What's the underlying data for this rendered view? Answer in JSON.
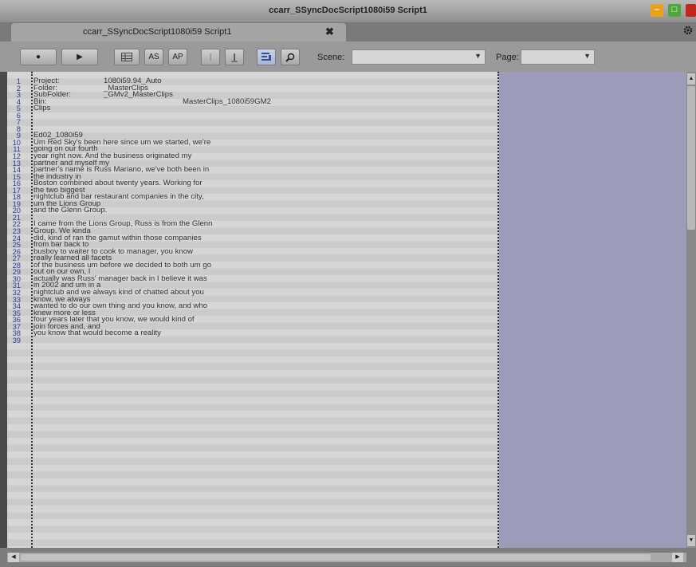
{
  "window": {
    "title": "ccarr_SSyncDocScript1080i59 Script1",
    "minimize_glyph": "–",
    "maximize_glyph": "□"
  },
  "tab": {
    "label": "ccarr_SSyncDocScript1080i59 Script1",
    "close_glyph": "✖"
  },
  "toolbar": {
    "record_glyph": "●",
    "play_glyph": "▶",
    "as_label": "AS",
    "ap_label": "AP",
    "scene_label": "Scene:",
    "scene_value": "",
    "page_label": "Page:",
    "page_value": ""
  },
  "icons": {
    "record": "record-icon",
    "play": "play-icon",
    "grid": "grid-icon",
    "text-cursor": "text-cursor-icon",
    "text-cursor-add": "text-cursor-add-icon",
    "script-lines": "script-lines-icon",
    "find": "find-icon",
    "settings": "gear-icon"
  },
  "colors": {
    "line_number": "#2d3b92",
    "page_background": "#d6d6d6",
    "margin_background": "#9c9cba"
  },
  "script": {
    "lines": [
      {
        "n": "1",
        "t": "Project:",
        "t2": "1080i59.94_Auto"
      },
      {
        "n": "2",
        "t": "Folder:",
        "t2": "_MasterClips"
      },
      {
        "n": "3",
        "t": "SubFolder:",
        "t2": "_GMv2_MasterClips"
      },
      {
        "n": "4",
        "t": "Bin:",
        "t3": "MasterClips_1080i59GM2"
      },
      {
        "n": "5",
        "t": "Clips"
      },
      {
        "n": "6",
        "t": ""
      },
      {
        "n": "7",
        "t": ""
      },
      {
        "n": "8",
        "t": ""
      },
      {
        "n": "9",
        "t": "Ed02_1080i59"
      },
      {
        "n": "10",
        "t": "Um Red Sky's been here since um we started, we're"
      },
      {
        "n": "11",
        "t": "going on our fourth"
      },
      {
        "n": "12",
        "t": "year right now.  And  the business originated my"
      },
      {
        "n": "13",
        "t": "partner and myself my"
      },
      {
        "n": "14",
        "t": "partner's name is Russ Mariano, we've both been in"
      },
      {
        "n": "15",
        "t": "the industry in"
      },
      {
        "n": "16",
        "t": "Boston combined about twenty years.  Working for"
      },
      {
        "n": "17",
        "t": "the two biggest"
      },
      {
        "n": "18",
        "t": "nightclub and bar restaurant companies in the city,"
      },
      {
        "n": "19",
        "t": "um the Lions Group"
      },
      {
        "n": "20",
        "t": "and the Glenn Group."
      },
      {
        "n": "21",
        "t": ""
      },
      {
        "n": "22",
        "t": "I came from the Lions Group, Russ is from the Glenn"
      },
      {
        "n": "23",
        "t": "Group.  We kinda"
      },
      {
        "n": "24",
        "t": "did, kind of ran the gamut within those companies"
      },
      {
        "n": "25",
        "t": "from bar back to"
      },
      {
        "n": "26",
        "t": "busboy to waiter to cook to manager, you know"
      },
      {
        "n": "27",
        "t": "really learned all facets"
      },
      {
        "n": "28",
        "t": "of the business um before we decided to both um go"
      },
      {
        "n": "29",
        "t": "out on our own, I"
      },
      {
        "n": "30",
        "t": "actually was Russ' manager back in I believe it was"
      },
      {
        "n": "31",
        "t": "in 2002 and um in a"
      },
      {
        "n": "32",
        "t": "nightclub and we always kind of chatted about you"
      },
      {
        "n": "33",
        "t": "know, we always"
      },
      {
        "n": "34",
        "t": "wanted to do our own thing and you know, and who"
      },
      {
        "n": "35",
        "t": "knew more or less"
      },
      {
        "n": "36",
        "t": "four years later that you know, we would kind of"
      },
      {
        "n": "37",
        "t": "join forces and, and"
      },
      {
        "n": "38",
        "t": "you know that would become a reality"
      },
      {
        "n": "39",
        "t": ""
      }
    ]
  },
  "scrollbars": {
    "up_glyph": "▲",
    "down_glyph": "▼",
    "left_glyph": "◀",
    "right_glyph": "▶"
  }
}
